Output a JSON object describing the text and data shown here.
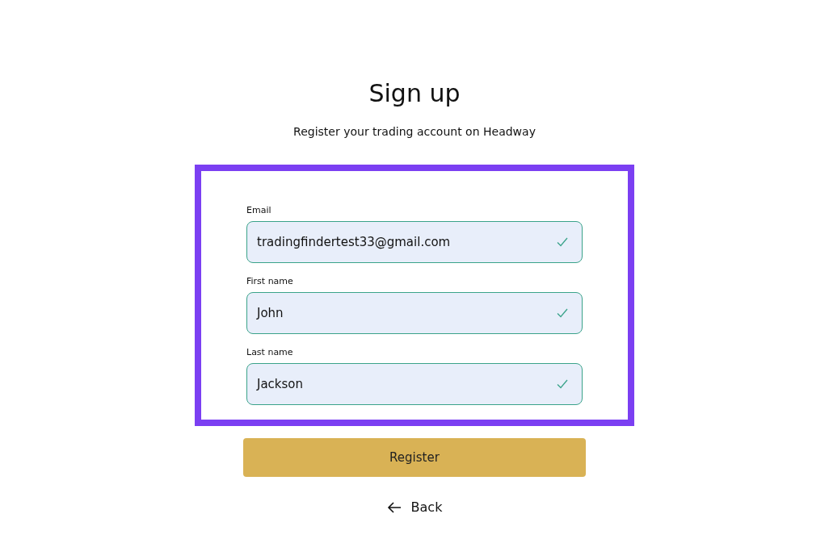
{
  "title": "Sign up",
  "subtitle": "Register your trading account on Headway",
  "highlight": {
    "on": true
  },
  "fields": [
    {
      "label": "Email",
      "value": "tradingfindertest33@gmail.com",
      "valid": true
    },
    {
      "label": "First name",
      "value": "John",
      "valid": true
    },
    {
      "label": "Last name",
      "value": "Jackson",
      "valid": true
    }
  ],
  "submit_button": "Register",
  "back_link": "Back"
}
